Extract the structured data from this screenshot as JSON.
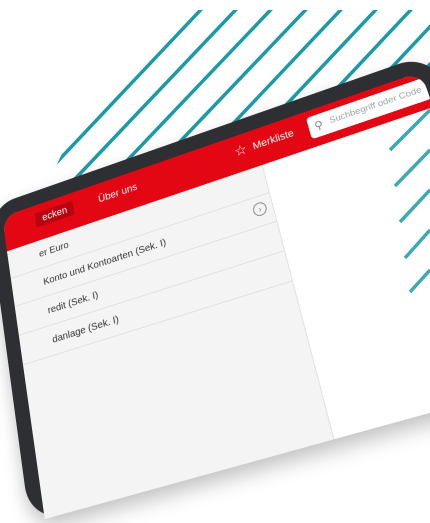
{
  "nav": {
    "active_tab": "ecken",
    "about_tab": "Über uns",
    "merkliste": "Merkliste",
    "search_placeholder": "Suchbegriff oder Code"
  },
  "sidebar": {
    "items": [
      {
        "label": "er Euro",
        "has_chevron": false
      },
      {
        "label": "Konto und Kontoarten (Sek. I)",
        "has_chevron": true
      },
      {
        "label": "redit (Sek. I)",
        "has_chevron": false
      },
      {
        "label": "danlage (Sek. I)",
        "has_chevron": false
      }
    ]
  },
  "colors": {
    "brand_red": "#e30613",
    "stripe_teal": "#1b9aa8",
    "device": "#2d2f33"
  },
  "icons": {
    "star": "star-icon",
    "search": "search-icon",
    "chevron": "chevron-right-icon"
  }
}
